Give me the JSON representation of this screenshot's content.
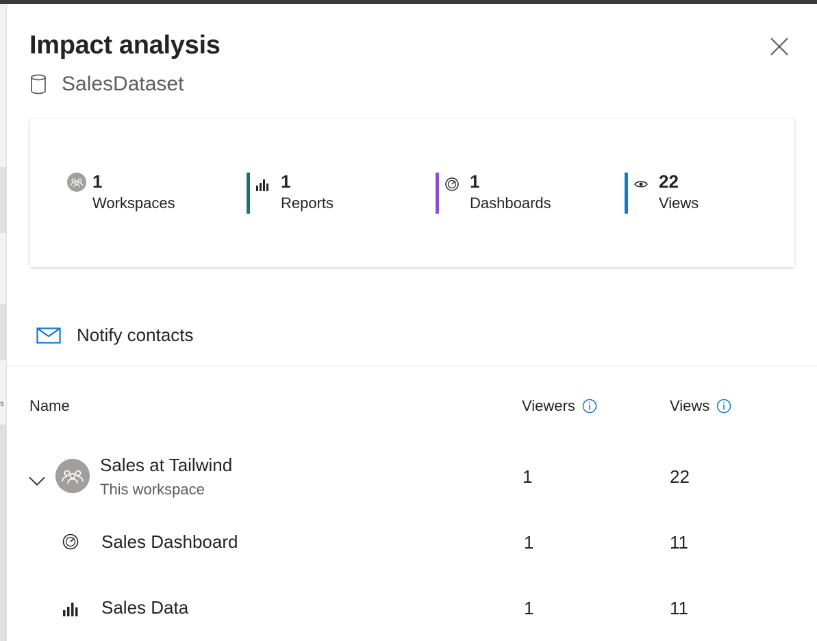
{
  "panel": {
    "title": "Impact analysis",
    "subtitle": "SalesDataset",
    "subtitle_icon": "database-icon",
    "close_icon": "close-icon"
  },
  "summary": [
    {
      "key": "workspaces",
      "value": "1",
      "label": "Workspaces",
      "icon": "workspace-icon",
      "color": "#a19f9d"
    },
    {
      "key": "reports",
      "value": "1",
      "label": "Reports",
      "icon": "bar-chart-icon",
      "color": "#197278"
    },
    {
      "key": "dashboards",
      "value": "1",
      "label": "Dashboards",
      "icon": "dashboard-gauge-icon",
      "color": "#8a50c8"
    },
    {
      "key": "views",
      "value": "22",
      "label": "Views",
      "icon": "eye-icon",
      "color": "#0e78d5"
    }
  ],
  "notify": {
    "label": "Notify contacts",
    "icon": "mail-icon",
    "color": "#0e78d5"
  },
  "table": {
    "headers": {
      "name": "Name",
      "viewers": "Viewers",
      "views": "Views"
    },
    "info_icon": "info-icon",
    "workspace_row": {
      "name": "Sales at Tailwind",
      "sub": "This workspace",
      "viewers": "1",
      "views": "22",
      "icon": "workspace-icon",
      "expand_icon": "chevron-down-icon"
    },
    "items": [
      {
        "name": "Sales Dashboard",
        "viewers": "1",
        "views": "11",
        "icon": "dashboard-gauge-icon"
      },
      {
        "name": "Sales Data",
        "viewers": "1",
        "views": "11",
        "icon": "bar-chart-icon"
      }
    ]
  }
}
